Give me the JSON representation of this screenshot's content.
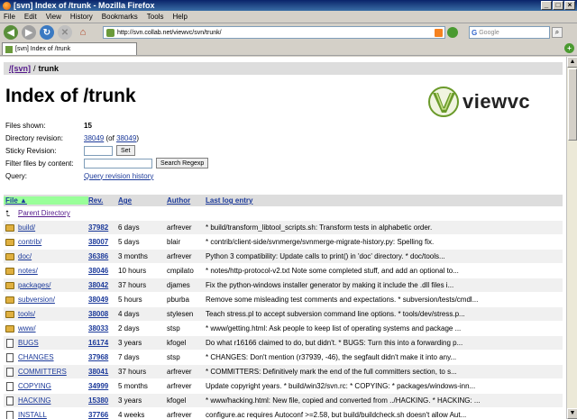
{
  "window": {
    "title": "[svn] Index of /trunk - Mozilla Firefox",
    "minimize": "_",
    "maximize": "□",
    "close": "×"
  },
  "menu": [
    "File",
    "Edit",
    "View",
    "History",
    "Bookmarks",
    "Tools",
    "Help"
  ],
  "nav": {
    "url": "http://svn.collab.net/viewvc/svn/trunk/",
    "search_placeholder": "Google"
  },
  "tab": {
    "label": "[svn] Index of /trunk"
  },
  "breadcrumb": {
    "root": "/[svn]",
    "sep": "/",
    "current": "trunk"
  },
  "page": {
    "title": "Index of /trunk",
    "logo_text": "viewvc"
  },
  "info": {
    "files_shown_label": "Files shown:",
    "files_shown_value": "15",
    "dir_rev_label": "Directory revision:",
    "dir_rev_value": "38049",
    "dir_rev_of_prefix": "(of",
    "dir_rev_of_value": "38049",
    "dir_rev_of_suffix": ")",
    "sticky_label": "Sticky Revision:",
    "set_button": "Set",
    "filter_label": "Filter files by content:",
    "search_button": "Search Regexp",
    "query_label": "Query:",
    "query_link": "Query revision history"
  },
  "table": {
    "headers": {
      "file": "File ▲",
      "rev": "Rev.",
      "age": "Age",
      "author": "Author",
      "log": "Last log entry"
    },
    "parent": "Parent Directory",
    "rows": [
      {
        "name": "build/",
        "type": "dir",
        "rev": "37982",
        "age": "6 days",
        "author": "arfrever",
        "log": "* build/transform_libtool_scripts.sh: Transform tests in alphabetic order."
      },
      {
        "name": "contrib/",
        "type": "dir",
        "rev": "38007",
        "age": "5 days",
        "author": "blair",
        "log": "* contrib/client-side/svnmerge/svnmerge-migrate-history.py: Spelling fix."
      },
      {
        "name": "doc/",
        "type": "dir",
        "rev": "36386",
        "age": "3 months",
        "author": "arfrever",
        "log": "Python 3 compatibility: Update calls to print() in 'doc' directory. * doc/tools..."
      },
      {
        "name": "notes/",
        "type": "dir",
        "rev": "38046",
        "age": "10 hours",
        "author": "cmpilato",
        "log": "* notes/http-protocol-v2.txt Note some completed stuff, and add an optional to..."
      },
      {
        "name": "packages/",
        "type": "dir",
        "rev": "38042",
        "age": "37 hours",
        "author": "djames",
        "log": "Fix the python-windows installer generator by making it include the .dll files i..."
      },
      {
        "name": "subversion/",
        "type": "dir",
        "rev": "38049",
        "age": "5 hours",
        "author": "pburba",
        "log": "Remove some misleading test comments and expectations. * subversion/tests/cmdl..."
      },
      {
        "name": "tools/",
        "type": "dir",
        "rev": "38008",
        "age": "4 days",
        "author": "stylesen",
        "log": "Teach stress.pl to accept subversion command line options. * tools/dev/stress.p..."
      },
      {
        "name": "www/",
        "type": "dir",
        "rev": "38033",
        "age": "2 days",
        "author": "stsp",
        "log": "* www/getting.html: Ask people to keep list of operating systems and package ..."
      },
      {
        "name": "BUGS",
        "type": "file",
        "rev": "16174",
        "age": "3 years",
        "author": "kfogel",
        "log": "Do what r16166 claimed to do, but didn't. * BUGS: Turn this into a forwarding p..."
      },
      {
        "name": "CHANGES",
        "type": "file",
        "rev": "37968",
        "age": "7 days",
        "author": "stsp",
        "log": "* CHANGES: Don't mention (r37939, -46), the segfault didn't make it into any..."
      },
      {
        "name": "COMMITTERS",
        "type": "file",
        "rev": "38041",
        "age": "37 hours",
        "author": "arfrever",
        "log": "* COMMITTERS: Definitively mark the end of the full committers section, to s..."
      },
      {
        "name": "COPYING",
        "type": "file",
        "rev": "34999",
        "age": "5 months",
        "author": "arfrever",
        "log": "Update copyright years. * build/win32/svn.rc: * COPYING: * packages/windows-inn..."
      },
      {
        "name": "HACKING",
        "type": "file",
        "rev": "15380",
        "age": "3 years",
        "author": "kfogel",
        "log": "* www/hacking.html: New file, copied and converted from ../HACKING. * HACKING: ..."
      },
      {
        "name": "INSTALL",
        "type": "file",
        "rev": "37766",
        "age": "4 weeks",
        "author": "arfrever",
        "log": "configure.ac requires Autoconf >=2.58, but build/buildcheck.sh doesn't allow Aut..."
      }
    ]
  },
  "colors": {
    "link": "#1c3a9a",
    "visited": "#551a8b",
    "header_bg": "#dddddd",
    "active_sort": "#99ff99"
  }
}
